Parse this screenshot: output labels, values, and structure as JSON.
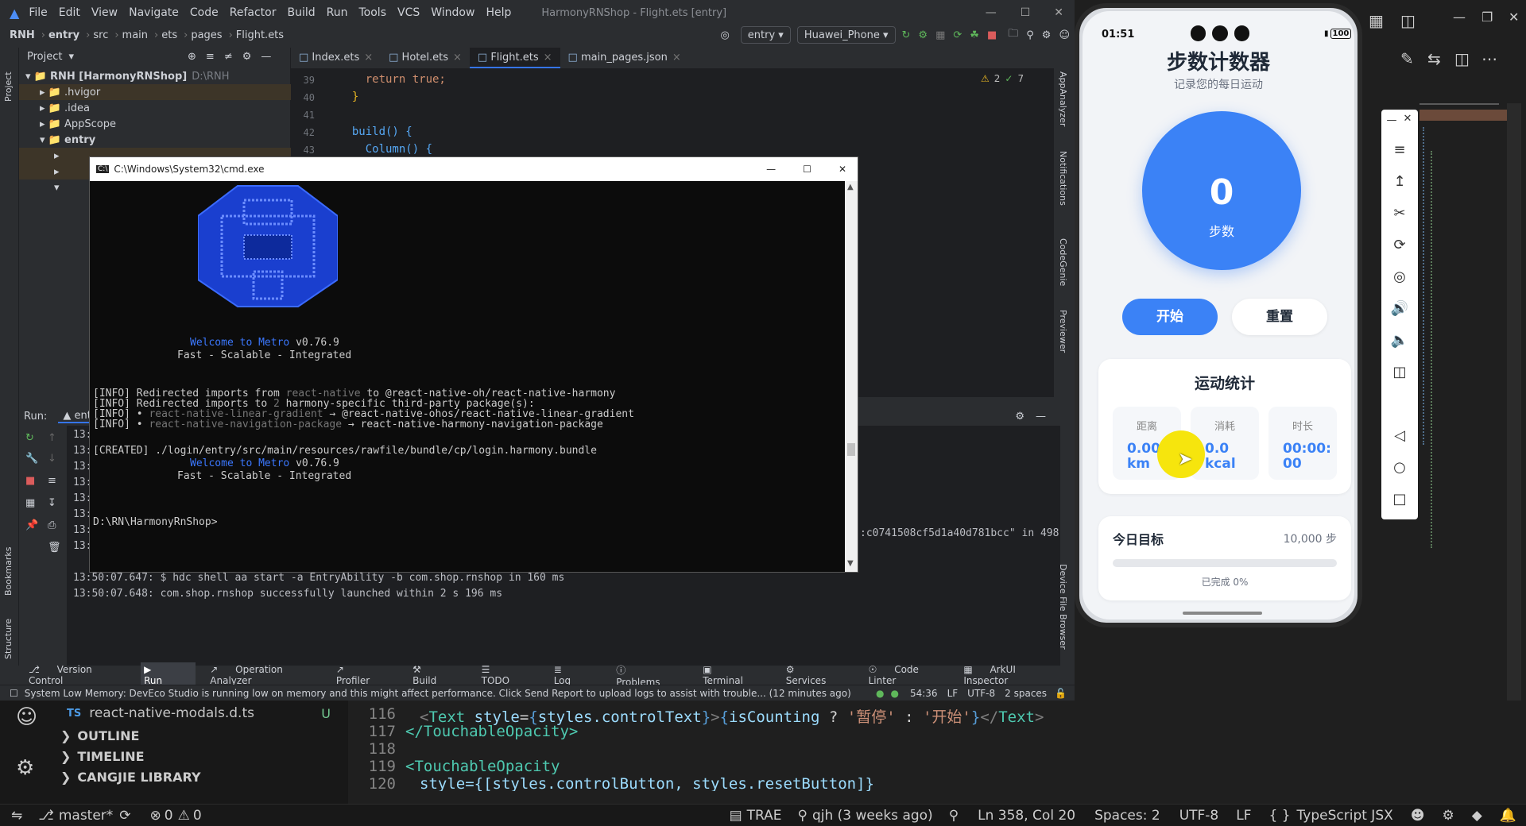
{
  "ide": {
    "menu": [
      "File",
      "Edit",
      "View",
      "Navigate",
      "Code",
      "Refactor",
      "Build",
      "Run",
      "Tools",
      "VCS",
      "Window",
      "Help"
    ],
    "title": "HarmonyRNShop - Flight.ets [entry]",
    "breadcrumb": [
      "RNH",
      "entry",
      "src",
      "main",
      "ets",
      "pages",
      "Flight.ets"
    ],
    "run_config": "entry",
    "device": "Huawei_Phone",
    "project_label": "Project",
    "tree": [
      {
        "label": "RNH [HarmonyRNShop]",
        "extra": "D:\\RNH"
      },
      {
        "label": ".hvigor"
      },
      {
        "label": ".idea"
      },
      {
        "label": "AppScope"
      },
      {
        "label": "entry"
      }
    ],
    "tabs": [
      "Index.ets",
      "Hotel.ets",
      "Flight.ets",
      "main_pages.json"
    ],
    "code_lines": [
      {
        "n": "39",
        "text": "    return true;"
      },
      {
        "n": "40",
        "text": "  }"
      },
      {
        "n": "41",
        "text": ""
      },
      {
        "n": "42",
        "text": "  build() {"
      },
      {
        "n": "43",
        "text": "    Column() {"
      }
    ],
    "inspections": {
      "warnings": "2",
      "weak": "7"
    },
    "run_label": "Run:",
    "run_tab": "entry",
    "log_lines": [
      "13:",
      "13:",
      "13:",
      "13:",
      "13:",
      "13:",
      "13:",
      "13:",
      "13:50:07.647: $ hdc shell aa start -a EntryAbility -b com.shop.rnshop in 160 ms",
      "13:50:07.648: com.shop.rnshop successfully launched within 2 s 196 ms"
    ],
    "log_tail": ":c0741508cf5d1a40d781bcc\" in 498",
    "bottom_tabs": [
      "Version Control",
      "Run",
      "Operation Analyzer",
      "Profiler",
      "Build",
      "TODO",
      "Log",
      "Problems",
      "Terminal",
      "Services",
      "Code Linter",
      "ArkUI Inspector"
    ],
    "status_msg": "System Low Memory: DevEco Studio is running low on memory and this might affect performance. Click Send Report to upload logs to assist with trouble... (12 minutes ago)",
    "status_right": [
      "54:36",
      "LF",
      "UTF-8",
      "2 spaces"
    ],
    "side_tools": [
      "AppAnalyzer",
      "Notifications",
      "CodeGenie",
      "Previewer",
      "Device File Browser"
    ],
    "left_tools": [
      "Project",
      "Bookmarks",
      "Structure"
    ]
  },
  "cmd": {
    "title": "C:\\Windows\\System32\\cmd.exe",
    "welcome1": "Welcome to Metro",
    "version1": "v0.76.9",
    "tagline1": "Fast - Scalable - Integrated",
    "info_lines": [
      {
        "tag": "[INFO]",
        "pre": " Redirected imports from ",
        "grey": "react-native",
        "post": " to @react-native-oh/react-native-harmony"
      },
      {
        "tag": "[INFO]",
        "pre": " Redirected imports to ",
        "grey": "2",
        "post": " harmony-specific third-party package(s):"
      },
      {
        "tag": "[INFO]",
        "pre": " • ",
        "grey": "react-native-linear-gradient",
        "post": " → @react-native-ohos/react-native-linear-gradient"
      },
      {
        "tag": "[INFO]",
        "pre": " • ",
        "grey": "react-native-navigation-package",
        "post": " → react-native-harmony-navigation-package"
      }
    ],
    "created": "[CREATED] ./login/entry/src/main/resources/rawfile/bundle/cp/login.harmony.bundle",
    "welcome2": "Welcome to Metro",
    "version2": "v0.76.9",
    "tagline2": "Fast - Scalable - Integrated",
    "prompt": "D:\\RN\\HarmonyRnShop>"
  },
  "phone": {
    "time": "01:51",
    "battery": "100",
    "title": "步数计数器",
    "subtitle": "记录您的每日运动",
    "steps": "0",
    "steps_label": "步数",
    "start_btn": "开始",
    "reset_btn": "重置",
    "stats_title": "运动统计",
    "stats": [
      {
        "label": "距离",
        "value": "0.00",
        "unit": "km"
      },
      {
        "label": "消耗",
        "value": "0.0",
        "unit": "kcal"
      },
      {
        "label": "时长",
        "value": "00:00:",
        "unit": "00"
      }
    ],
    "goal_title": "今日目标",
    "goal_value": "10,000 步",
    "goal_progress": 0,
    "goal_done": "已完成 0%"
  },
  "vscode": {
    "file": "react-native-modals.d.ts",
    "file_badge": "U",
    "file_lang": "TS",
    "sections": [
      "OUTLINE",
      "TIMELINE",
      "CANGJIE LIBRARY"
    ],
    "lines": [
      {
        "n": "116",
        "text": "<Text style={styles.controlText}>{isCounting ? '暂停' : '开始'}</Text>"
      },
      {
        "n": "117",
        "text": "</TouchableOpacity>"
      },
      {
        "n": "118",
        "text": ""
      },
      {
        "n": "119",
        "text": "<TouchableOpacity"
      },
      {
        "n": "120",
        "text": "style={[styles.controlButton, styles.resetButton]}"
      }
    ],
    "status": {
      "branch": "master*",
      "errors": "0",
      "warnings": "0",
      "trae": "TRAE",
      "blame": "qjh (3 weeks ago)",
      "position": "Ln 358, Col 20",
      "spaces": "Spaces: 2",
      "encoding": "UTF-8",
      "eol": "LF",
      "language": "TypeScript JSX"
    }
  },
  "colors": {
    "accent": "#3b82f6",
    "cursor": "#f5e400"
  }
}
